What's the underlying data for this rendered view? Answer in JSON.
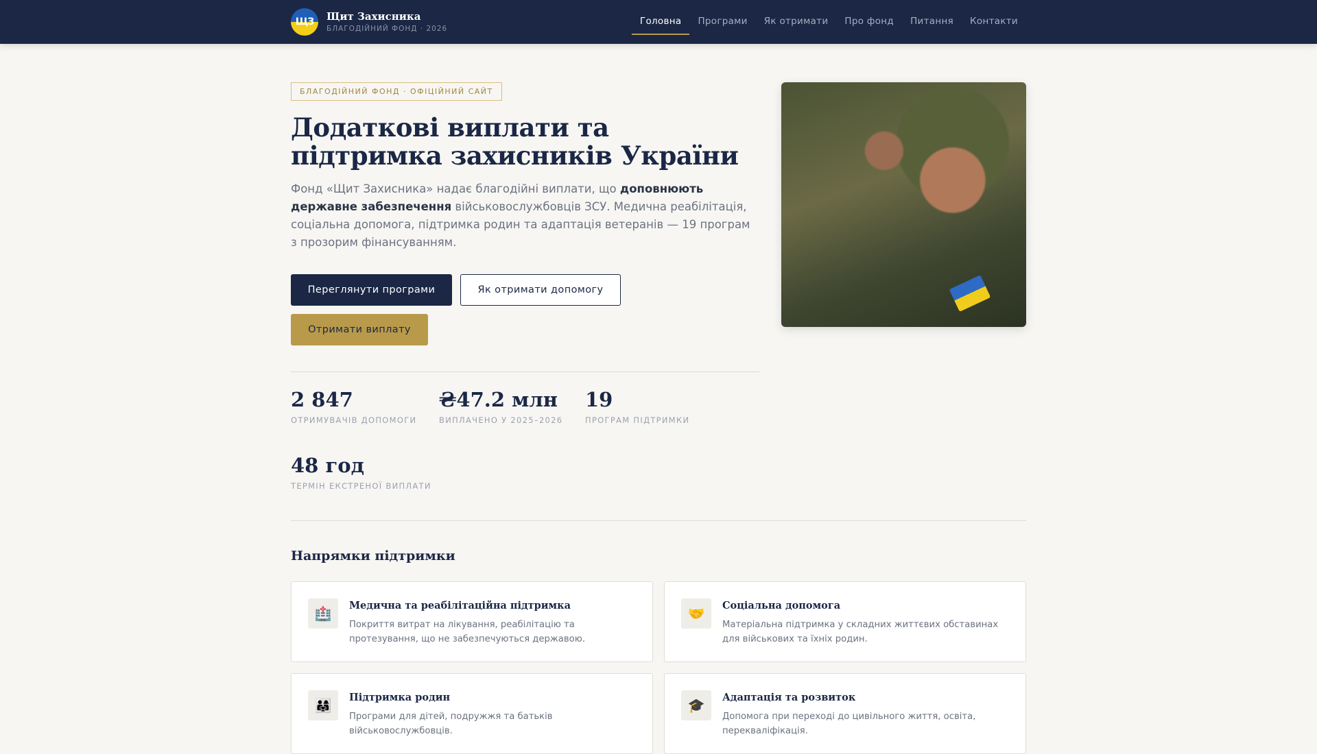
{
  "nav": {
    "logo_text": "ЩЗ",
    "brand": "Щит Захисника",
    "brand_sub": "БЛАГОДІЙНИЙ ФОНД · 2026",
    "items": [
      "Головна",
      "Програми",
      "Як отримати",
      "Про фонд",
      "Питання",
      "Контакти"
    ]
  },
  "hero": {
    "tag": "БЛАГОДІЙНИЙ ФОНД · ОФІЦІЙНИЙ САЙТ",
    "title": "Додаткові виплати та підтримка захисників України",
    "lead_1": "Фонд «Щит Захисника» надає благодійні виплати, що ",
    "lead_bold": "доповнюють державне забезпечення",
    "lead_2": " військовослужбовців ЗСУ. Медична реабілітація, соціальна допомога, підтримка родин та адаптація ветеранів — 19 програм з прозорим фінансуванням.",
    "btn_programs": "Переглянути програми",
    "btn_how": "Як отримати допомогу",
    "btn_payment": "Отримати виплату"
  },
  "stats": [
    {
      "value": "2 847",
      "label": "ОТРИМУВАЧІВ ДОПОМОГИ"
    },
    {
      "value": "₴47.2 млн",
      "label": "ВИПЛАЧЕНО У 2025–2026"
    },
    {
      "value": "19",
      "label": "ПРОГРАМ ПІДТРИМКИ"
    },
    {
      "value": "48 год",
      "label": "ТЕРМІН ЕКСТРЕНОЇ ВИПЛАТИ"
    }
  ],
  "section": {
    "title": "Напрямки підтримки",
    "cards": [
      {
        "icon": "🏥",
        "title": "Медична та реабілітаційна підтримка",
        "desc": "Покриття витрат на лікування, реабілітацію та протезування, що не забезпечуються державою."
      },
      {
        "icon": "🤝",
        "title": "Соціальна допомога",
        "desc": "Матеріальна підтримка у складних життєвих обставинах для військових та їхніх родин."
      },
      {
        "icon": "👨‍👩‍👧",
        "title": "Підтримка родин",
        "desc": "Програми для дітей, подружжя та батьків військовослужбовців."
      },
      {
        "icon": "🎓",
        "title": "Адаптація та розвиток",
        "desc": "Допомога при переході до цивільного життя, освіта, перекваліфікація."
      }
    ]
  },
  "colors": {
    "navy": "#1b2745",
    "gold": "#b89a4a",
    "bg": "#f7f6f3"
  }
}
